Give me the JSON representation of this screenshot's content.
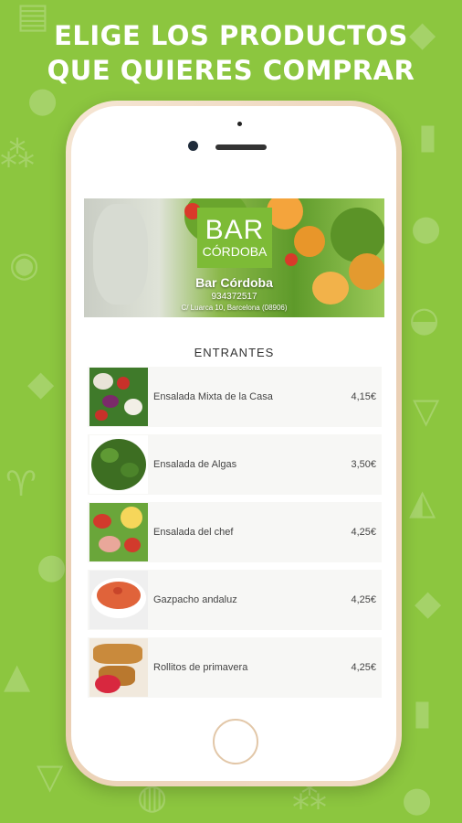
{
  "headline": {
    "line1": "ELIGE LOS PRODUCTOS",
    "line2": "QUE QUIERES COMPRAR"
  },
  "restaurant": {
    "logo_line1": "BAR",
    "logo_line2": "CÓRDOBA",
    "name": "Bar Córdoba",
    "phone": "934372517",
    "address": "C/ Luarca 10, Barcelona (08906)"
  },
  "menu": {
    "section_title": "ENTRANTES",
    "products": [
      {
        "name": "Ensalada Mixta de la Casa",
        "price": "4,15€"
      },
      {
        "name": "Ensalada de Algas",
        "price": "3,50€"
      },
      {
        "name": "Ensalada del chef",
        "price": "4,25€"
      },
      {
        "name": "Gazpacho andaluz",
        "price": "4,25€"
      },
      {
        "name": "Rollitos de primavera",
        "price": "4,25€"
      }
    ]
  },
  "colors": {
    "background": "#8cc63f",
    "brand": "#7dbb36"
  }
}
